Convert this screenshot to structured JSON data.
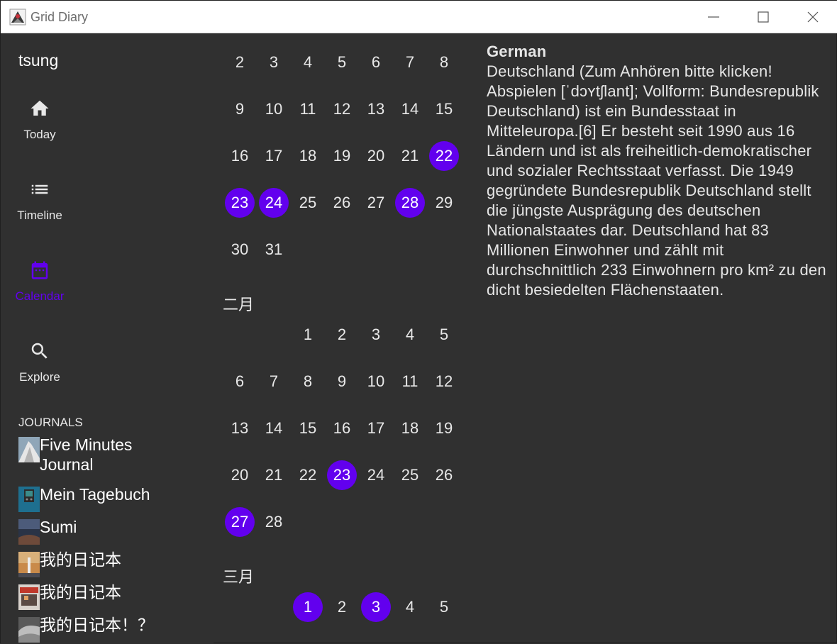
{
  "window": {
    "title": "Grid Diary",
    "controls": [
      "minimize-icon",
      "maximize-icon",
      "close-icon"
    ]
  },
  "sidebar": {
    "user": "tsung",
    "nav": [
      {
        "label": "Today",
        "icon": "home-icon",
        "active": false
      },
      {
        "label": "Timeline",
        "icon": "list-icon",
        "active": false
      },
      {
        "label": "Calendar",
        "icon": "calendar-icon",
        "active": true
      },
      {
        "label": "Explore",
        "icon": "search-icon",
        "active": false
      }
    ],
    "journals_header": "JOURNALS",
    "journals": [
      {
        "name": "Five Minutes Journal"
      },
      {
        "name": "Mein Tagebuch"
      },
      {
        "name": "Sumi"
      },
      {
        "name": "我的日记本"
      },
      {
        "name": "我的日记本"
      },
      {
        "name": "我的日记本！？"
      }
    ]
  },
  "calendar": {
    "months": [
      {
        "label": "",
        "first_weekday": 0,
        "days": [
          2,
          3,
          4,
          5,
          6,
          7,
          8,
          9,
          10,
          11,
          12,
          13,
          14,
          15,
          16,
          17,
          18,
          19,
          20,
          21,
          22,
          23,
          24,
          25,
          26,
          27,
          28,
          29,
          30,
          31
        ],
        "entries": [
          22,
          23,
          24,
          28
        ]
      },
      {
        "label": "二月",
        "first_weekday": 2,
        "days": [
          1,
          2,
          3,
          4,
          5,
          6,
          7,
          8,
          9,
          10,
          11,
          12,
          13,
          14,
          15,
          16,
          17,
          18,
          19,
          20,
          21,
          22,
          23,
          24,
          25,
          26,
          27,
          28
        ],
        "entries": [
          23,
          27
        ]
      },
      {
        "label": "三月",
        "first_weekday": 2,
        "days": [
          1,
          2,
          3,
          4,
          5
        ],
        "entries": [
          1,
          3
        ]
      }
    ]
  },
  "entry": {
    "title": "German",
    "body": "Deutschland (Zum Anhören bitte klicken! Abspielen [ˈdɔʏtʃlant]; Vollform: Bundesrepublik Deutschland) ist ein Bundesstaat in Mitteleuropa.[6] Er besteht seit 1990 aus 16 Ländern und ist als freiheitlich-demokratischer und sozialer Rechtsstaat verfasst. Die 1949 gegründete Bundesrepublik Deutschland stellt die jüngste Ausprägung des deutschen Nationalstaates dar. Deutschland hat 83 Millionen Einwohner und zählt mit durchschnittlich 233 Einwohnern pro km² zu den dicht besiedelten Flächenstaaten."
  },
  "colors": {
    "accent": "#6200ee",
    "background": "#303030",
    "text": "#e8e8e8"
  }
}
